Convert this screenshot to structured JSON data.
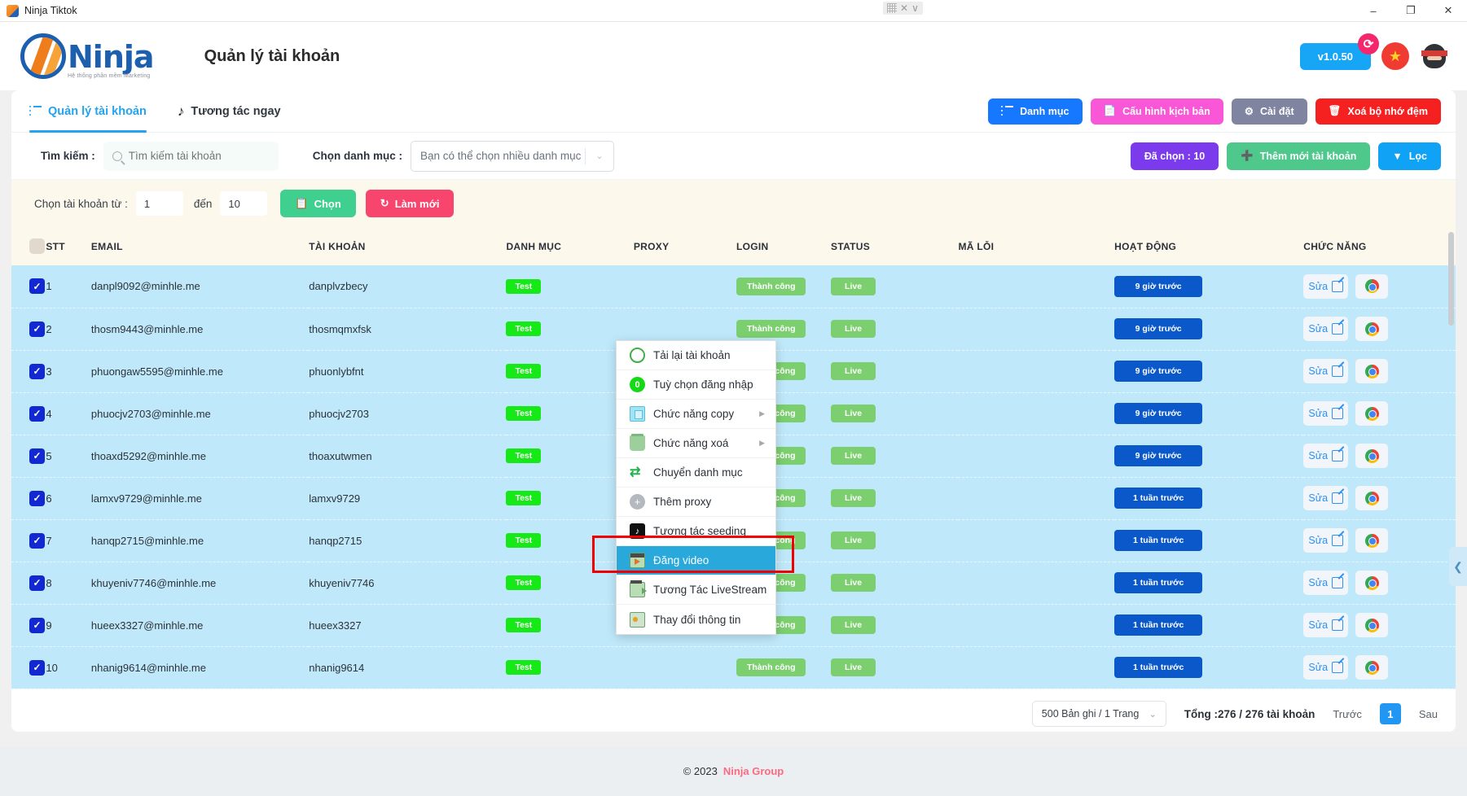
{
  "window": {
    "title": "Ninja Tiktok",
    "app_icon": "ninja-app-icon",
    "minimize": "–",
    "maximize": "❐",
    "close": "✕",
    "center_x": "✕",
    "center_chevron": "∨"
  },
  "brand": {
    "logo_name": "Ninja",
    "logo_sub": "Hệ thống phần mềm Marketing",
    "page_title": "Quản lý tài khoản",
    "version": "v1.0.50",
    "version_badge_icon": "⟳",
    "flag_icon": "★",
    "avatar_icon": "ninja-avatar"
  },
  "tabs": [
    {
      "label": "Quản lý tài khoản",
      "icon": "list-icon",
      "active": true
    },
    {
      "label": "Tương tác ngay",
      "icon": "tiktok-icon",
      "active": false
    }
  ],
  "toolbar": [
    {
      "label": "Danh mục",
      "icon": "list-icon",
      "color": "#1677ff"
    },
    {
      "label": "Cấu hình kịch bản",
      "icon": "file-plus-icon",
      "color": "#f957d8"
    },
    {
      "label": "Cài đặt",
      "icon": "gear-icon",
      "color": "#7f84a0"
    },
    {
      "label": "Xoá bộ nhớ đệm",
      "icon": "trash-icon",
      "color": "#f52020"
    }
  ],
  "search": {
    "label": "Tìm kiếm :",
    "placeholder": "Tìm kiếm tài khoản",
    "value": "",
    "icon": "search-icon",
    "category_label": "Chọn danh mục :",
    "category_value": "Bạn có thể chọn nhiều danh mục",
    "category_chevron": "⌄"
  },
  "search_actions": [
    {
      "label": "Đã chọn : 10",
      "icon": "",
      "color": "#7c3aed"
    },
    {
      "label": "Thêm mới tài khoản",
      "icon": "plus-circle-icon",
      "color": "#4fc98b"
    },
    {
      "label": "Lọc",
      "icon": "filter-icon",
      "color": "#0fa2f5"
    }
  ],
  "range": {
    "label": "Chọn tài khoản từ :",
    "from": "1",
    "middle": "đến",
    "to": "10",
    "select_button": "Chọn",
    "select_icon": "clipboard-icon",
    "refresh_button": "Làm mới",
    "refresh_icon": "refresh-icon"
  },
  "table": {
    "headers": [
      "",
      "STT",
      "EMAIL",
      "TÀI KHOẢN",
      "DANH MỤC",
      "PROXY",
      "LOGIN",
      "STATUS",
      "MÃ LỖI",
      "HOẠT ĐỘNG",
      "CHỨC NĂNG"
    ],
    "rows": [
      {
        "checked": true,
        "stt": "1",
        "email": "danpl9092@minhle.me",
        "account": "danplvzbecy",
        "category": "Test",
        "proxy": "",
        "login": "Thành công",
        "status": "Live",
        "error": "",
        "activity": "9 giờ trước",
        "edit": "Sửa"
      },
      {
        "checked": true,
        "stt": "2",
        "email": "thosm9443@minhle.me",
        "account": "thosmqmxfsk",
        "category": "Test",
        "proxy": "",
        "login": "Thành công",
        "status": "Live",
        "error": "",
        "activity": "9 giờ trước",
        "edit": "Sửa"
      },
      {
        "checked": true,
        "stt": "3",
        "email": "phuongaw5595@minhle.me",
        "account": "phuonlybfnt",
        "category": "Test",
        "proxy": "",
        "login": "Thành công",
        "status": "Live",
        "error": "",
        "activity": "9 giờ trước",
        "edit": "Sửa"
      },
      {
        "checked": true,
        "stt": "4",
        "email": "phuocjv2703@minhle.me",
        "account": "phuocjv2703",
        "category": "Test",
        "proxy": "",
        "login": "Thành công",
        "status": "Live",
        "error": "",
        "activity": "9 giờ trước",
        "edit": "Sửa"
      },
      {
        "checked": true,
        "stt": "5",
        "email": "thoaxd5292@minhle.me",
        "account": "thoaxutwmen",
        "category": "Test",
        "proxy": "",
        "login": "Thành công",
        "status": "Live",
        "error": "",
        "activity": "9 giờ trước",
        "edit": "Sửa"
      },
      {
        "checked": true,
        "stt": "6",
        "email": "lamxv9729@minhle.me",
        "account": "lamxv9729",
        "category": "Test",
        "proxy": "",
        "login": "Thành công",
        "status": "Live",
        "error": "",
        "activity": "1 tuần trước",
        "edit": "Sửa"
      },
      {
        "checked": true,
        "stt": "7",
        "email": "hanqp2715@minhle.me",
        "account": "hanqp2715",
        "category": "Test",
        "proxy": "",
        "login": "Thành công",
        "status": "Live",
        "error": "",
        "activity": "1 tuần trước",
        "edit": "Sửa"
      },
      {
        "checked": true,
        "stt": "8",
        "email": "khuyeniv7746@minhle.me",
        "account": "khuyeniv7746",
        "category": "Test",
        "proxy": "",
        "login": "Thành công",
        "status": "Live",
        "error": "",
        "activity": "1 tuần trước",
        "edit": "Sửa"
      },
      {
        "checked": true,
        "stt": "9",
        "email": "hueex3327@minhle.me",
        "account": "hueex3327",
        "category": "Test",
        "proxy": "",
        "login": "Thành công",
        "status": "Live",
        "error": "",
        "activity": "1 tuần trước",
        "edit": "Sửa"
      },
      {
        "checked": true,
        "stt": "10",
        "email": "nhanig9614@minhle.me",
        "account": "nhanig9614",
        "category": "Test",
        "proxy": "",
        "login": "Thành công",
        "status": "Live",
        "error": "",
        "activity": "1 tuần trước",
        "edit": "Sửa"
      }
    ]
  },
  "context_menu": {
    "items": [
      {
        "label": "Tải lại tài khoản",
        "icon": "reload-icon",
        "submenu": false,
        "selected": false
      },
      {
        "label": "Tuỳ chọn đăng nhập",
        "icon": "login-icon",
        "submenu": false,
        "selected": false
      },
      {
        "label": "Chức năng copy",
        "icon": "copy-icon",
        "submenu": true,
        "selected": false
      },
      {
        "label": "Chức năng xoá",
        "icon": "trash-icon",
        "submenu": true,
        "selected": false
      },
      {
        "label": "Chuyển danh mục",
        "icon": "swap-icon",
        "submenu": false,
        "selected": false
      },
      {
        "label": "Thêm proxy",
        "icon": "plus-circle-icon",
        "submenu": false,
        "selected": false
      },
      {
        "label": "Tương tác seeding",
        "icon": "tiktok-icon",
        "submenu": false,
        "selected": false
      },
      {
        "label": "Đăng video",
        "icon": "video-icon",
        "submenu": false,
        "selected": true
      },
      {
        "label": "Tương Tác LiveStream",
        "icon": "livestream-icon",
        "submenu": false,
        "selected": false
      },
      {
        "label": "Thay đổi thông tin",
        "icon": "info-edit-icon",
        "submenu": false,
        "selected": false
      }
    ],
    "highlight_color": "#f00000"
  },
  "pagination": {
    "page_size": "500 Bản ghi / 1 Trang",
    "chevron": "⌄",
    "total": "Tổng :276 / 276 tài khoản",
    "prev": "Trước",
    "current": "1",
    "next": "Sau"
  },
  "footer": {
    "copyright": "© 2023",
    "brand": "Ninja Group"
  },
  "side_handle": {
    "icon": "❮"
  }
}
